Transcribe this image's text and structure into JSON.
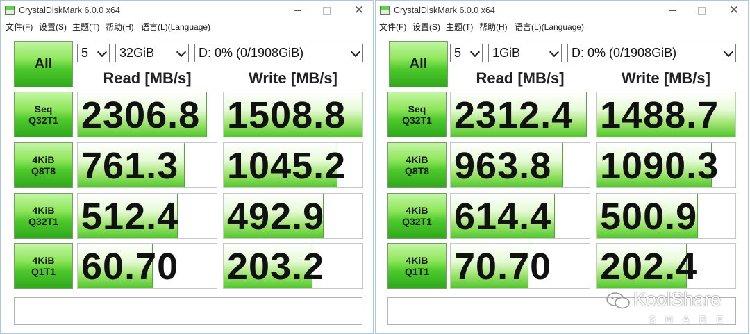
{
  "windows": [
    {
      "title": "CrystalDiskMark 6.0.0 x64",
      "menu": [
        "文件(F)",
        "设置(S)",
        "主题(T)",
        "帮助(H)",
        "语言(L)(Language)"
      ],
      "all_label": "All",
      "count": "5",
      "size": "32GiB",
      "drive": "D: 0% (0/1908GiB)",
      "read_header": "Read [MB/s]",
      "write_header": "Write [MB/s]",
      "rows": [
        {
          "label": "Seq\nQ32T1",
          "read": "2306.8",
          "read_fill": 0.93,
          "write": "1508.8",
          "write_fill": 1.0
        },
        {
          "label": "4KiB\nQ8T8",
          "read": "761.3",
          "read_fill": 0.77,
          "write": "1045.2",
          "write_fill": 0.82
        },
        {
          "label": "4KiB\nQ32T1",
          "read": "512.4",
          "read_fill": 0.72,
          "write": "492.9",
          "write_fill": 0.72
        },
        {
          "label": "4KiB\nQ1T1",
          "read": "60.70",
          "read_fill": 0.54,
          "write": "203.2",
          "write_fill": 0.64
        }
      ],
      "status": ""
    },
    {
      "title": "CrystalDiskMark 6.0.0 x64",
      "menu": [
        "文件(F)",
        "设置(S)",
        "主题(T)",
        "帮助(H)",
        "语言(L)(Language)"
      ],
      "all_label": "All",
      "count": "5",
      "size": "1GiB",
      "drive": "D: 0% (0/1908GiB)",
      "read_header": "Read [MB/s]",
      "write_header": "Write [MB/s]",
      "rows": [
        {
          "label": "Seq\nQ32T1",
          "read": "2312.4",
          "read_fill": 0.98,
          "write": "1488.7",
          "write_fill": 1.0
        },
        {
          "label": "4KiB\nQ8T8",
          "read": "963.8",
          "read_fill": 0.81,
          "write": "1090.3",
          "write_fill": 0.83
        },
        {
          "label": "4KiB\nQ32T1",
          "read": "614.4",
          "read_fill": 0.75,
          "write": "500.9",
          "write_fill": 0.73
        },
        {
          "label": "4KiB\nQ1T1",
          "read": "70.70",
          "read_fill": 0.56,
          "write": "202.4",
          "write_fill": 0.65
        }
      ],
      "status": ""
    }
  ],
  "watermark": {
    "text": "KoolShare",
    "sub": "SHARE",
    "icon": "wechat-icon"
  },
  "colors": {
    "accent_green": "#4cc82b",
    "window_border": "#a9c7e6"
  }
}
